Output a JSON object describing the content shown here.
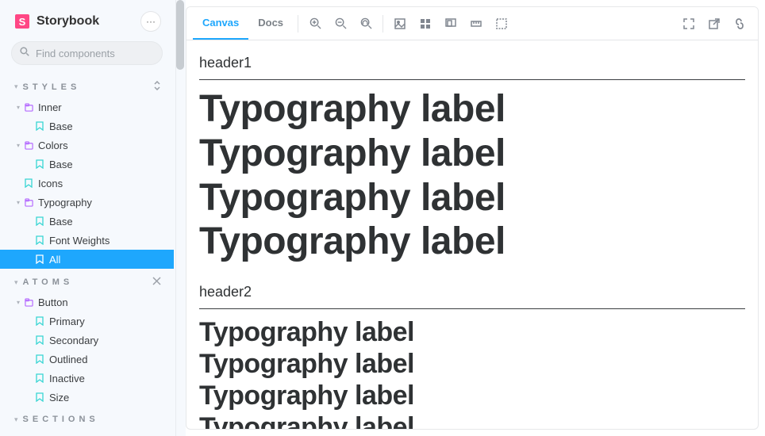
{
  "brand": {
    "title": "Storybook",
    "menu_glyph": "···"
  },
  "search": {
    "placeholder": "Find components",
    "shortcut": "/"
  },
  "sections": {
    "styles": {
      "label": "STYLES",
      "items": [
        {
          "label": "Inner",
          "children": [
            {
              "label": "Base"
            }
          ]
        },
        {
          "label": "Colors",
          "children": [
            {
              "label": "Base"
            }
          ]
        },
        {
          "label": "Icons"
        },
        {
          "label": "Typography",
          "children": [
            {
              "label": "Base"
            },
            {
              "label": "Font Weights"
            },
            {
              "label": "All",
              "selected": true
            }
          ]
        }
      ]
    },
    "atoms": {
      "label": "ATOMS",
      "items": [
        {
          "label": "Button",
          "children": [
            {
              "label": "Primary"
            },
            {
              "label": "Secondary"
            },
            {
              "label": "Outlined"
            },
            {
              "label": "Inactive"
            },
            {
              "label": "Size"
            }
          ]
        }
      ]
    },
    "sections": {
      "label": "SECTIONS"
    }
  },
  "toolbar": {
    "tabs": [
      "Canvas",
      "Docs"
    ],
    "active_tab": "Canvas"
  },
  "canvas": {
    "groups": [
      {
        "heading": "header1",
        "class": "h1",
        "lines": [
          "Typography label",
          "Typography label",
          "Typography label",
          "Typography label"
        ]
      },
      {
        "heading": "header2",
        "class": "h2",
        "lines": [
          "Typography label",
          "Typography label",
          "Typography label",
          "Typography label"
        ]
      }
    ]
  }
}
